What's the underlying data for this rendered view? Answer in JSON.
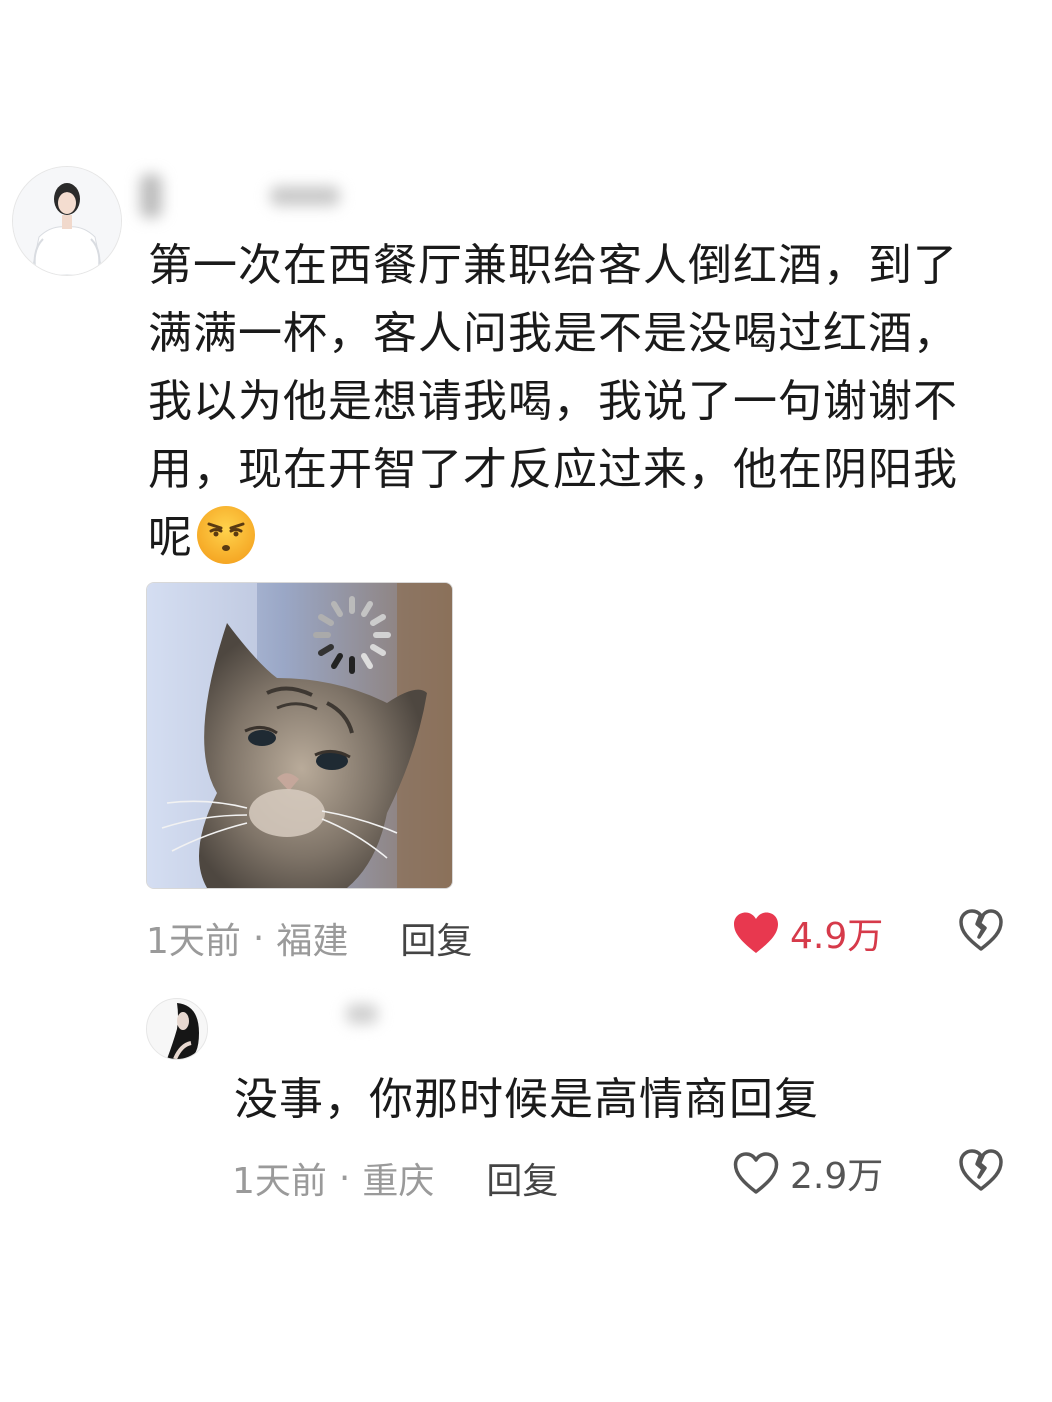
{
  "comments": [
    {
      "text": "第一次在西餐厅兼职给客人倒红酒，到了满满一杯，客人问我是不是没喝过红酒，我以为他是想请我喝，我说了一句谢谢不用，现在开智了才反应过来，他在阴阳我呢",
      "time": "1天前",
      "separator": "·",
      "location": "福建",
      "reply_label": "回复",
      "like_count": "4.9万",
      "liked": true,
      "avatar_icon": "user-avatar",
      "emoji_icon": "unamused-face-emoji",
      "image_icon": "cat-meme-image"
    },
    {
      "text": "没事，你那时候是高情商回复",
      "time": "1天前",
      "separator": "·",
      "location": "重庆",
      "reply_label": "回复",
      "like_count": "2.9万",
      "liked": false,
      "avatar_icon": "user-avatar"
    }
  ],
  "colors": {
    "liked_red": "#e8384f",
    "like_count_red": "#d63a4a",
    "meta_gray": "#9a9a9a",
    "text_dark": "#1a1a1a"
  }
}
